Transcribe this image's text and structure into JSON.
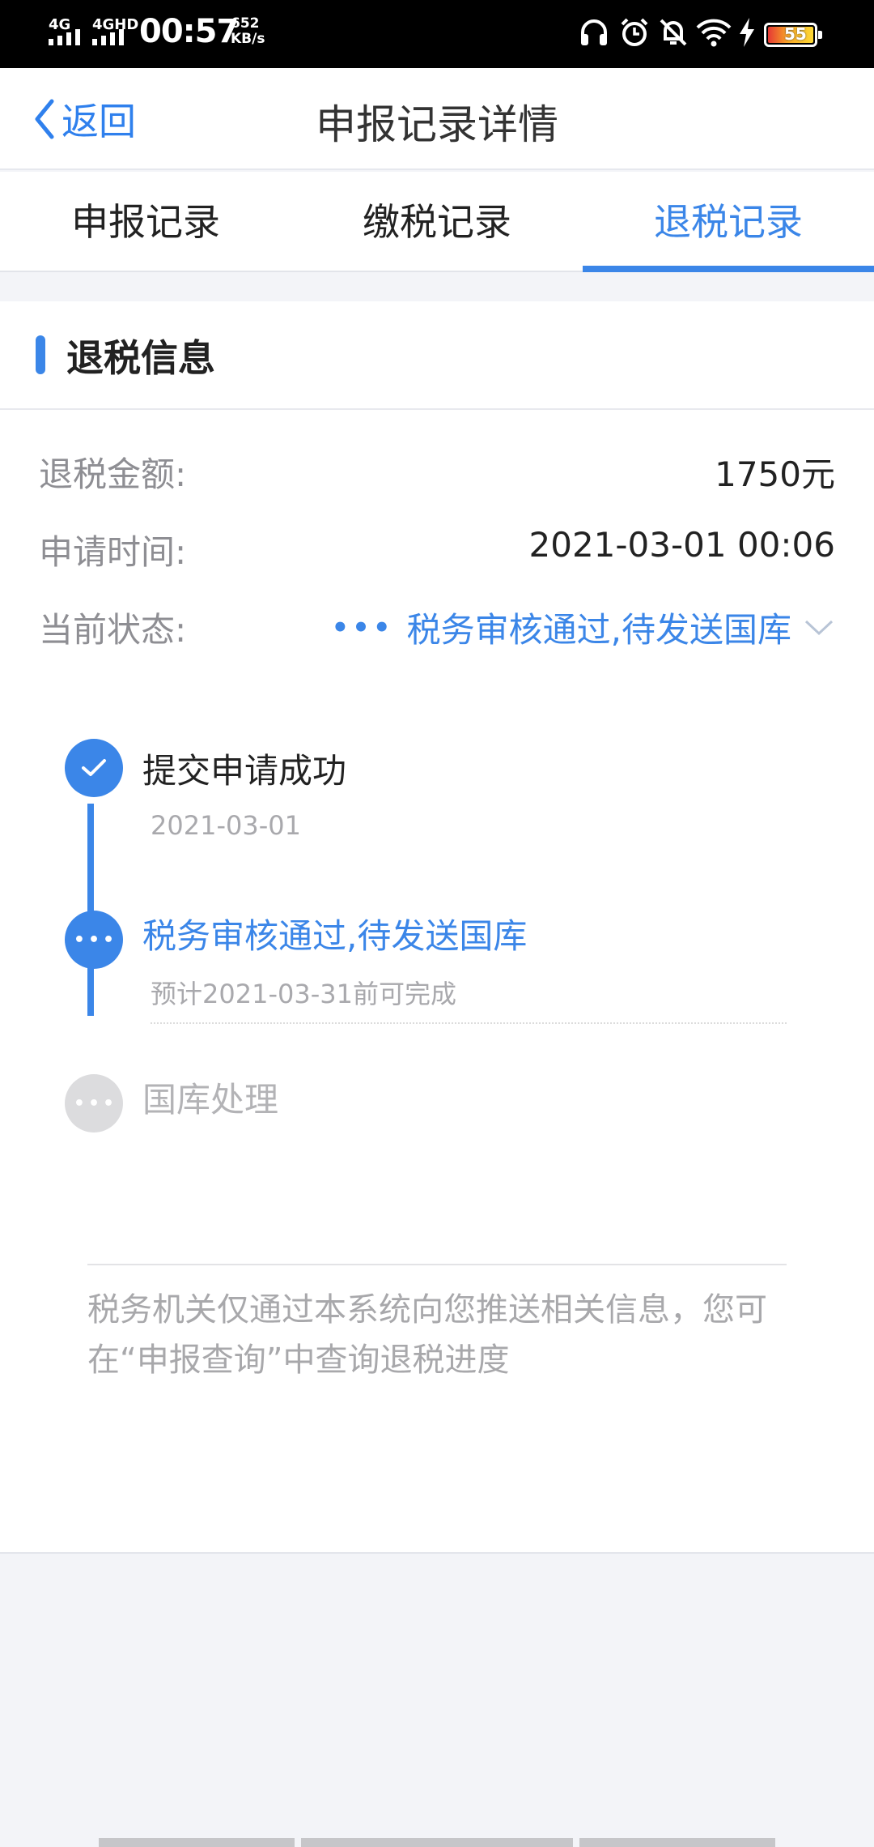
{
  "status_bar": {
    "sim1": "4G",
    "sim2": "4GHD",
    "time": "00:57",
    "speed_value": "652",
    "speed_unit": "KB/s",
    "battery_level": "55"
  },
  "header": {
    "back_label": "返回",
    "title": "申报记录详情"
  },
  "tabs": [
    {
      "label": "申报记录",
      "active": false
    },
    {
      "label": "缴税记录",
      "active": false
    },
    {
      "label": "退税记录",
      "active": true
    }
  ],
  "refund_info": {
    "section_title": "退税信息",
    "amount_label": "退税金额:",
    "amount_value": "1750元",
    "apply_time_label": "申请时间:",
    "apply_time_value": "2021-03-01 00:06",
    "status_label": "当前状态:",
    "status_value": "税务审核通过,待发送国库"
  },
  "timeline": [
    {
      "title": "提交申请成功",
      "sub": "2021-03-01",
      "state": "done"
    },
    {
      "title": "税务审核通过,待发送国库",
      "sub": "预计2021-03-31前可完成",
      "state": "current"
    },
    {
      "title": "国库处理",
      "sub": "",
      "state": "pending"
    }
  ],
  "note": "税务机关仅通过本系统向您推送相关信息，您可在“申报查询”中查询退税进度",
  "colors": {
    "accent": "#3b86e8",
    "muted": "#8e8e93",
    "background": "#f3f4f8"
  }
}
